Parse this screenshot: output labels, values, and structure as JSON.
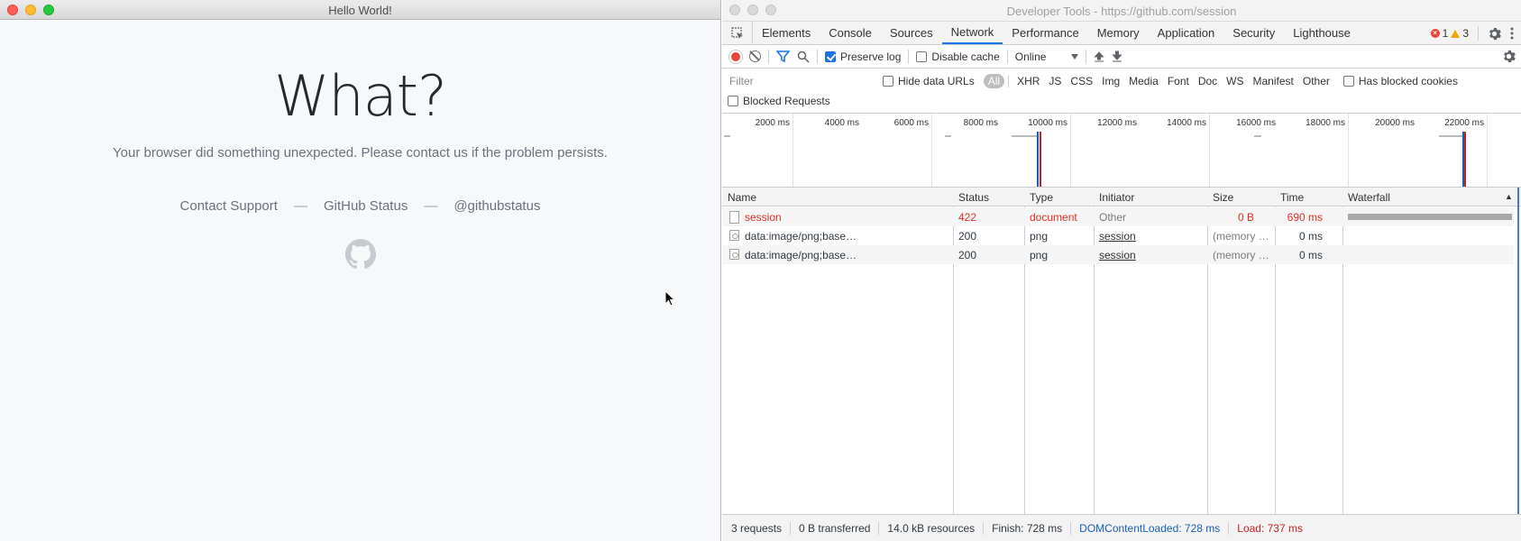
{
  "browser": {
    "window_title": "Hello World!",
    "heading": "What?",
    "message": "Your browser did something unexpected. Please contact us if the problem persists.",
    "links": {
      "contact": "Contact Support",
      "status": "GitHub Status",
      "twitter": "@githubstatus",
      "separator": "—"
    }
  },
  "devtools": {
    "window_title": "Developer Tools - https://github.com/session",
    "tabs": [
      "Elements",
      "Console",
      "Sources",
      "Network",
      "Performance",
      "Memory",
      "Application",
      "Security",
      "Lighthouse"
    ],
    "active_tab": "Network",
    "error_count": "1",
    "warning_count": "3",
    "toolbar": {
      "preserve_log": "Preserve log",
      "preserve_log_checked": true,
      "disable_cache": "Disable cache",
      "disable_cache_checked": false,
      "throttling": "Online"
    },
    "filter": {
      "placeholder": "Filter",
      "hide_data_urls": "Hide data URLs",
      "types": [
        "All",
        "XHR",
        "JS",
        "CSS",
        "Img",
        "Media",
        "Font",
        "Doc",
        "WS",
        "Manifest",
        "Other"
      ],
      "active_type": "All",
      "has_blocked_cookies": "Has blocked cookies",
      "blocked_requests": "Blocked Requests"
    },
    "overview": {
      "ticks": [
        "2000 ms",
        "4000 ms",
        "6000 ms",
        "8000 ms",
        "10000 ms",
        "12000 ms",
        "14000 ms",
        "16000 ms",
        "18000 ms",
        "20000 ms",
        "22000 ms"
      ]
    },
    "columns": {
      "name": "Name",
      "status": "Status",
      "type": "Type",
      "initiator": "Initiator",
      "size": "Size",
      "time": "Time",
      "waterfall": "Waterfall"
    },
    "requests": [
      {
        "name": "session",
        "status": "422",
        "type": "document",
        "initiator": "Other",
        "size": "0 B",
        "time": "690 ms"
      },
      {
        "name": "data:image/png;base…",
        "status": "200",
        "type": "png",
        "initiator": "session",
        "size": "(memory …",
        "time": "0 ms"
      },
      {
        "name": "data:image/png;base…",
        "status": "200",
        "type": "png",
        "initiator": "session",
        "size": "(memory …",
        "time": "0 ms"
      }
    ],
    "summary": {
      "requests": "3 requests",
      "transferred": "0 B transferred",
      "resources": "14.0 kB resources",
      "finish": "Finish: 728 ms",
      "dom_content_loaded": "DOMContentLoaded: 728 ms",
      "load": "Load: 737 ms"
    },
    "colors": {
      "accent": "#1a73e8",
      "error": "#d93025",
      "dcl_line": "#1a5fb4",
      "load_line": "#c5221f"
    }
  }
}
